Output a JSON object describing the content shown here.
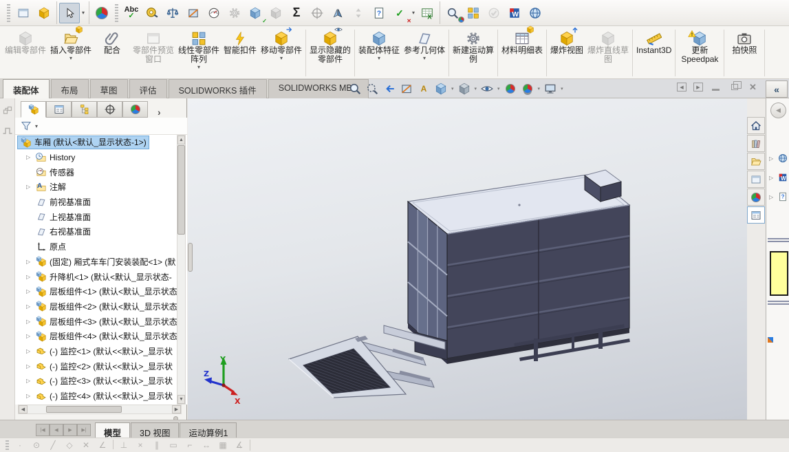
{
  "glyphs": {
    "caret": "▾",
    "expand": "▷",
    "more": "›",
    "collapse": "«",
    "left": "◀",
    "right": "▶",
    "up": "▲",
    "down": "▼",
    "first": "|◀",
    "last": "▶|",
    "close": "✕",
    "check": "✓",
    "cross": "✕"
  },
  "top_toolbar": {
    "spellcheck": "Abc",
    "equations": "Σ",
    "word": "W"
  },
  "ribbon": {
    "buttons": [
      "编辑零部件",
      "插入零部件",
      "配合",
      "零部件预览窗口",
      "线性零部件阵列",
      "智能扣件",
      "移动零部件",
      "显示隐藏的零部件",
      "装配体特征",
      "参考几何体",
      "新建运动算例",
      "材料明细表",
      "爆炸视图",
      "爆炸直线草图",
      "Instant3D",
      "更新 Speedpak",
      "拍快照"
    ]
  },
  "command_tabs": [
    "装配体",
    "布局",
    "草图",
    "评估",
    "SOLIDWORKS 插件",
    "SOLIDWORKS MBD"
  ],
  "headsup": {
    "annotation_label": "A"
  },
  "feature_tree": {
    "items": [
      "车厢  (默认<默认_显示状态-1>)",
      "History",
      "传感器",
      "注解",
      "前视基准面",
      "上视基准面",
      "右视基准面",
      "原点",
      "(固定) 厢式车车门安装装配<1> (默",
      "升降机<1> (默认<默认_显示状态-",
      "层板组件<1> (默认<默认_显示状态",
      "层板组件<2> (默认<默认_显示状态",
      "层板组件<3> (默认<默认_显示状态",
      "层板组件<4> (默认<默认_显示状态",
      "(-) 监控<1> (默认<<默认>_显示状",
      "(-) 监控<2> (默认<<默认>_显示状",
      "(-) 监控<3> (默认<<默认>_显示状",
      "(-) 监控<4> (默认<<默认>_显示状"
    ]
  },
  "document_tabs": [
    "模型",
    "3D 视图",
    "运动算例1"
  ],
  "statusbar": {
    "icons": [
      "·",
      "⊙",
      "╱",
      "◇",
      "✕",
      "∠",
      "⊥",
      "×",
      "∥",
      "▭",
      "⌐",
      "↔",
      "▦",
      "∡"
    ]
  },
  "colors": {
    "selection": "#aed3f2",
    "model_body": "#43455a",
    "model_roof": "#e2e6f0",
    "viewport_top": "#eff1f4",
    "viewport_bottom": "#c8ccd4",
    "triad_x": "#cc2020",
    "triad_y": "#1f9e1f",
    "triad_z": "#2233cc",
    "taskpane_swatch": "#ffff9c"
  }
}
